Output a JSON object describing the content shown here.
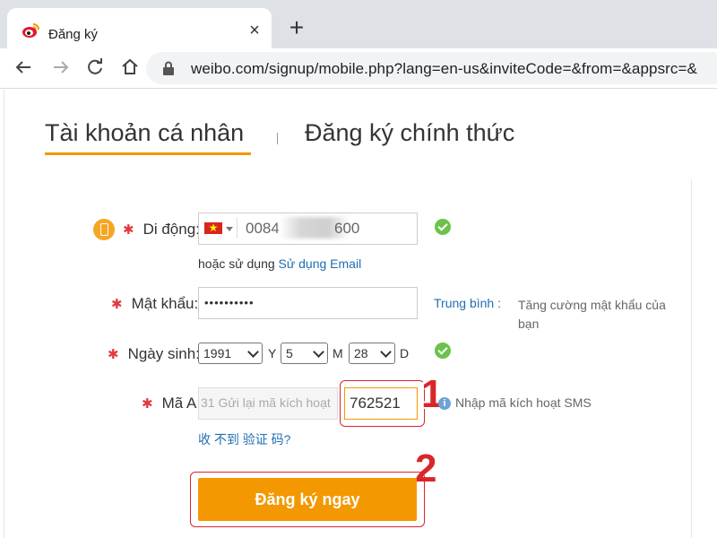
{
  "browser": {
    "tab_title": "Đăng ký",
    "tab_favicon": "weibo-logo-icon",
    "close_icon": "×",
    "new_tab_icon": "+",
    "url": "weibo.com/signup/mobile.php?lang=en-us&inviteCode=&from=&appsrc=&"
  },
  "tabs": {
    "personal": "Tài khoản cá nhân",
    "official": "Đăng ký chính thức",
    "active_color": "#f39800"
  },
  "form": {
    "phone": {
      "label": "Di động:",
      "country_prefix": "0084",
      "number_suffix": "600",
      "alt_prefix": "hoặc sử dụng",
      "alt_link": "Sử dụng Email"
    },
    "password": {
      "label": "Mật khẩu:",
      "value_masked": "••••••••••",
      "strength_label": "Trung bình :",
      "hint": "Tăng cường mật khẩu của bạn"
    },
    "birthday": {
      "label": "Ngày sinh:",
      "year": "1991",
      "year_unit": "Y",
      "month": "5",
      "month_unit": "M",
      "day": "28",
      "day_unit": "D"
    },
    "code": {
      "label": "Mã A:",
      "resend_text": "31 Gửi lại mã kích hoạt",
      "activation_value": "762521",
      "sms_hint": "Nhập mã kích hoạt SMS",
      "not_received_link": "收 不到 验证 码?"
    },
    "submit_label": "Đăng ký ngay"
  },
  "annotations": {
    "step1": "1",
    "step2": "2",
    "color": "#d9262b"
  }
}
